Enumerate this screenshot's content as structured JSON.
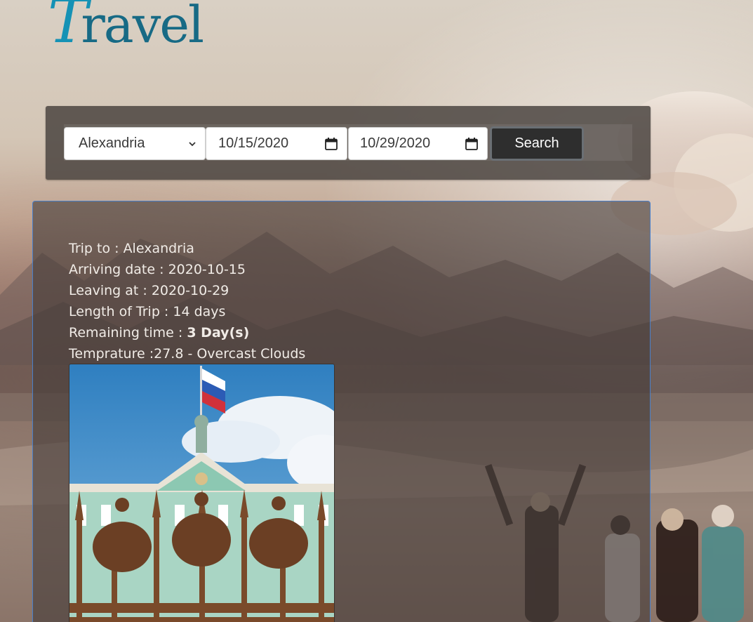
{
  "logo": {
    "first_letter": "T",
    "rest": "ravel"
  },
  "search": {
    "city": "Alexandria",
    "arrival_date": "10/15/2020",
    "departure_date": "10/29/2020",
    "button_label": "Search"
  },
  "result": {
    "trip_label": "Trip to : ",
    "trip_value": "Alexandria",
    "arriving_label": "Arriving date : ",
    "arriving_value": "2020-10-15",
    "leaving_label": "Leaving at : ",
    "leaving_value": "2020-10-29",
    "length_label": "Length of Trip : ",
    "length_value": "14 days",
    "remaining_label": "Remaining time : ",
    "remaining_value": "3 Day(s)",
    "temp_label": "Temprature :",
    "temp_value": "27.8 - Overcast Clouds"
  },
  "icons": {
    "select": "chevron-down-icon",
    "date": "calendar-icon"
  }
}
